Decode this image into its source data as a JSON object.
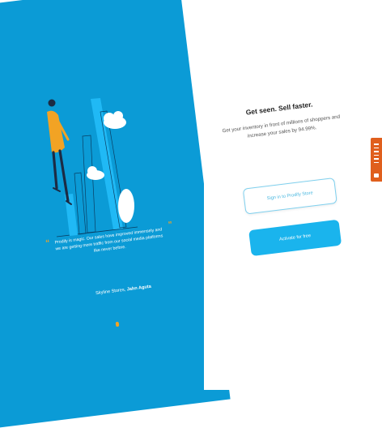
{
  "testimonial": {
    "open_quote": "“",
    "close_quote": "”",
    "text": "Prodify is magic. Our sales have improved immensely and we are getting more traffic from our social media platforms like never before.",
    "author_name": "Skyline Stores,",
    "author_role": "Jahn Aguta"
  },
  "signup": {
    "headline": "Get seen. Sell faster.",
    "subtitle": "Get your inventory in front of millions of shoppers and increase your sales by 94.99%.",
    "signin_button": "Sign in to Prodify Store",
    "activate_button": "Activate for free"
  },
  "colors": {
    "panel_blue": "#0b9bd6",
    "accent_orange": "#f2a324",
    "button_blue": "#1ab4ed",
    "side_tab": "#e05f1d"
  }
}
